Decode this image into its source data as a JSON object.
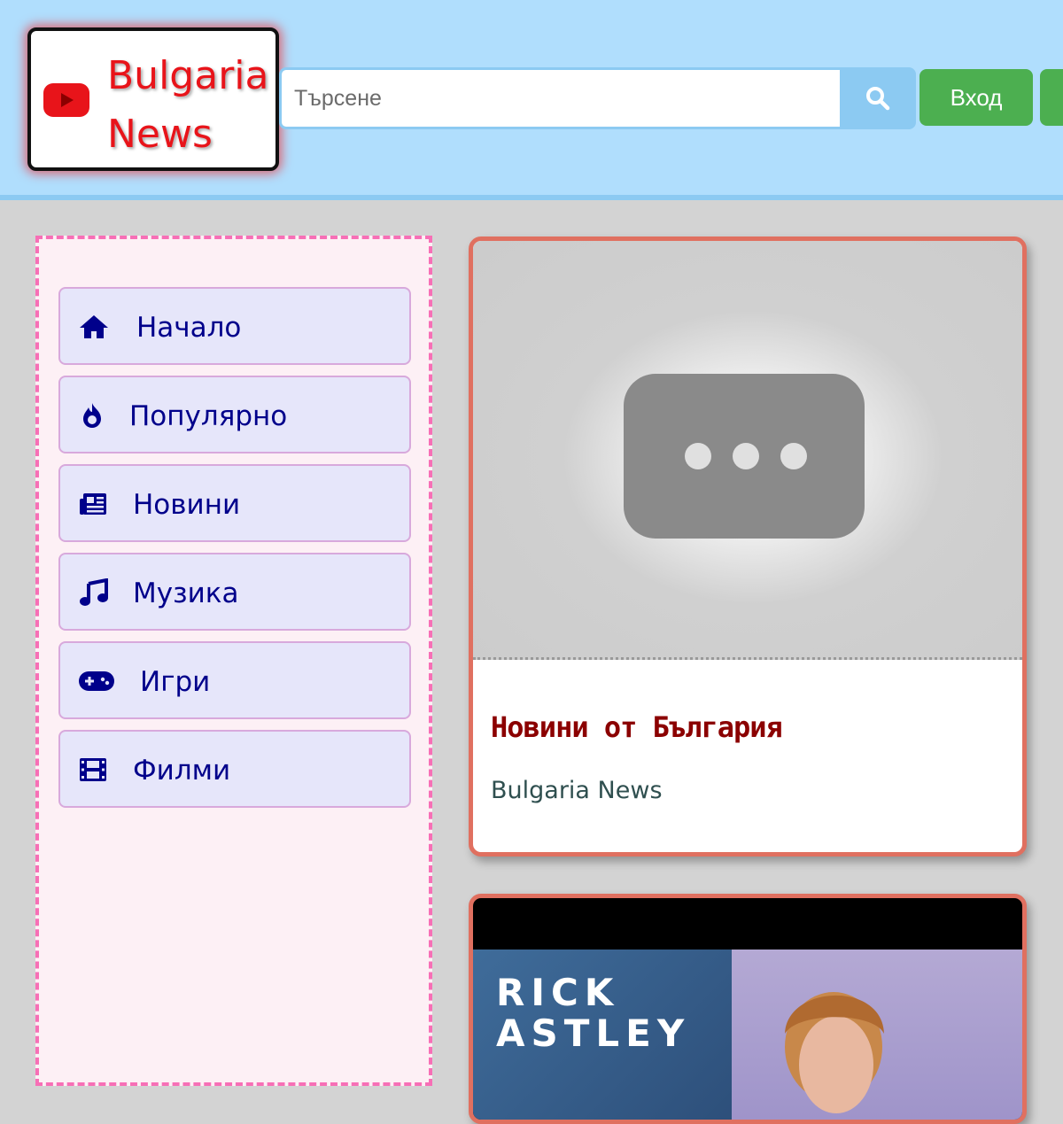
{
  "header": {
    "logo_text": "Bulgaria News",
    "search_placeholder": "Търсене",
    "login_label": "Вход"
  },
  "sidebar": {
    "items": [
      {
        "label": "Начало",
        "icon": "home-icon"
      },
      {
        "label": "Популярно",
        "icon": "fire-icon"
      },
      {
        "label": "Новини",
        "icon": "newspaper-icon"
      },
      {
        "label": "Музика",
        "icon": "music-icon"
      },
      {
        "label": "Игри",
        "icon": "gamepad-icon"
      },
      {
        "label": "Филми",
        "icon": "film-icon"
      }
    ]
  },
  "videos": [
    {
      "title": "Новини от България",
      "channel": "Bulgaria News"
    },
    {
      "thumbnail_text": "RICK ASTLEY"
    }
  ],
  "colors": {
    "header_bg": "#b0defd",
    "accent_red": "#e8141a",
    "nav_text": "#00008b",
    "login_green": "#4caf50",
    "card_title": "#8b0000"
  }
}
